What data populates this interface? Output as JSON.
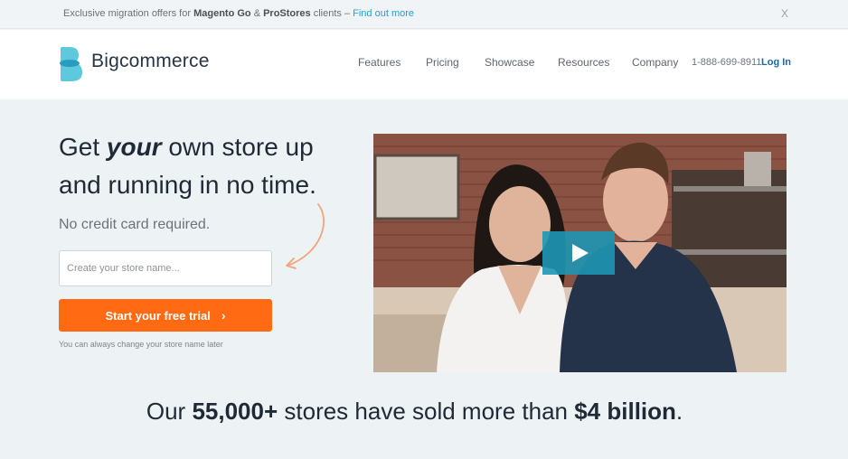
{
  "promo": {
    "prefix": "Exclusive migration offers for ",
    "brand1": "Magento Go",
    "amp": " & ",
    "brand2": "ProStores",
    "suffix": " clients – ",
    "link": "Find out more",
    "close": "X"
  },
  "header": {
    "logo_text": "Bigcommerce",
    "logo_icon": "bigcommerce-logo-icon",
    "nav": [
      "Features",
      "Pricing",
      "Showcase",
      "Resources",
      "Company"
    ],
    "phone": "1-888-699-8911",
    "login": "Log In"
  },
  "hero": {
    "title_1": "Get ",
    "title_em": "your",
    "title_2": " own store up and running in no time.",
    "subtitle": "No credit card required.",
    "input_placeholder": "Create your store name...",
    "cta_label": "Start your free trial",
    "cta_icon": "›",
    "hint": "You can always change your store name later"
  },
  "video": {
    "play_icon": "play-icon"
  },
  "stats": {
    "prefix": "Our ",
    "stores": "55,000+",
    "middle": " stores have sold more than ",
    "amount": "$4 billion",
    "suffix": "."
  },
  "colors": {
    "accent_orange": "#ff6a13",
    "link_blue": "#2b9bd6",
    "play_teal": "#1e96b4",
    "background": "#edf2f4"
  }
}
